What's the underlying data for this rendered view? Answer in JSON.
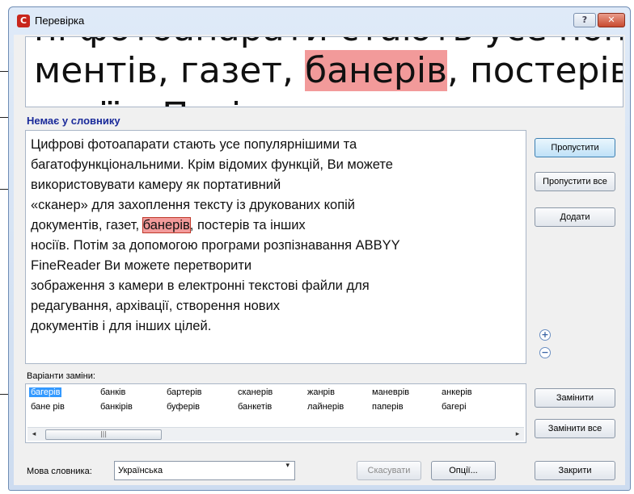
{
  "window": {
    "title": "Перевірка"
  },
  "titlebar": {
    "help_glyph": "?",
    "close_glyph": "✕"
  },
  "zoom_preview": {
    "ghost_top": "ні фотоапарати стають усе популяр",
    "before": "ментів, газет, ",
    "highlight": "банерів",
    "after": ", постерів та і",
    "ghost_bottom": "носіїв. Потім за допомогою"
  },
  "dictionary_status": "Немає у словнику",
  "text_body": {
    "line1": "Цифрові фотоапарати стають усе популярнішими та",
    "line2": "багатофункціональними. Крім відомих функцій, Ви можете",
    "line3": "використовувати камеру як портативний",
    "line4": "«сканер» для захоплення тексту із друкованих копій",
    "line5_before": "документів, газет, ",
    "line5_highlight": "банерів",
    "line5_after": ", постерів та інших",
    "line6": "носіїв. Потім за допомогою програми розпізнавання ABBYY",
    "line7": "FineReader Ви можете перетворити",
    "line8": "зображення з камери в електронні текстові файли для",
    "line9": "редагування, архівації, створення нових",
    "line10": "документів і для інших цілей."
  },
  "buttons": {
    "skip": "Пропустити",
    "skip_all": "Пропустити все",
    "add": "Додати",
    "replace": "Замінити",
    "replace_all": "Замінити все",
    "close": "Закрити",
    "cancel": "Скасувати",
    "options": "Опції..."
  },
  "zoom_controls": {
    "plus": "+",
    "minus": "−"
  },
  "variants": {
    "label": "Варіанти заміни:",
    "row1": [
      "багерів",
      "банків",
      "бартерів",
      "сканерів",
      "жанрів",
      "маневрів",
      "анкерів"
    ],
    "row2": [
      "бане рів",
      "банкірів",
      "буферів",
      "банкетів",
      "лайнерів",
      "паперів",
      "багері"
    ],
    "selected": "багерів",
    "scrollbar": {
      "left_arrow": "◂",
      "thumb_grip": "|||",
      "right_arrow": "▸"
    }
  },
  "language": {
    "label": "Мова словника:",
    "value": "Українська",
    "arrow": "▾"
  },
  "icons": [
    "app-logo-icon",
    "help-icon",
    "close-icon",
    "zoom-in-icon",
    "zoom-out-icon",
    "dropdown-arrow-icon"
  ]
}
